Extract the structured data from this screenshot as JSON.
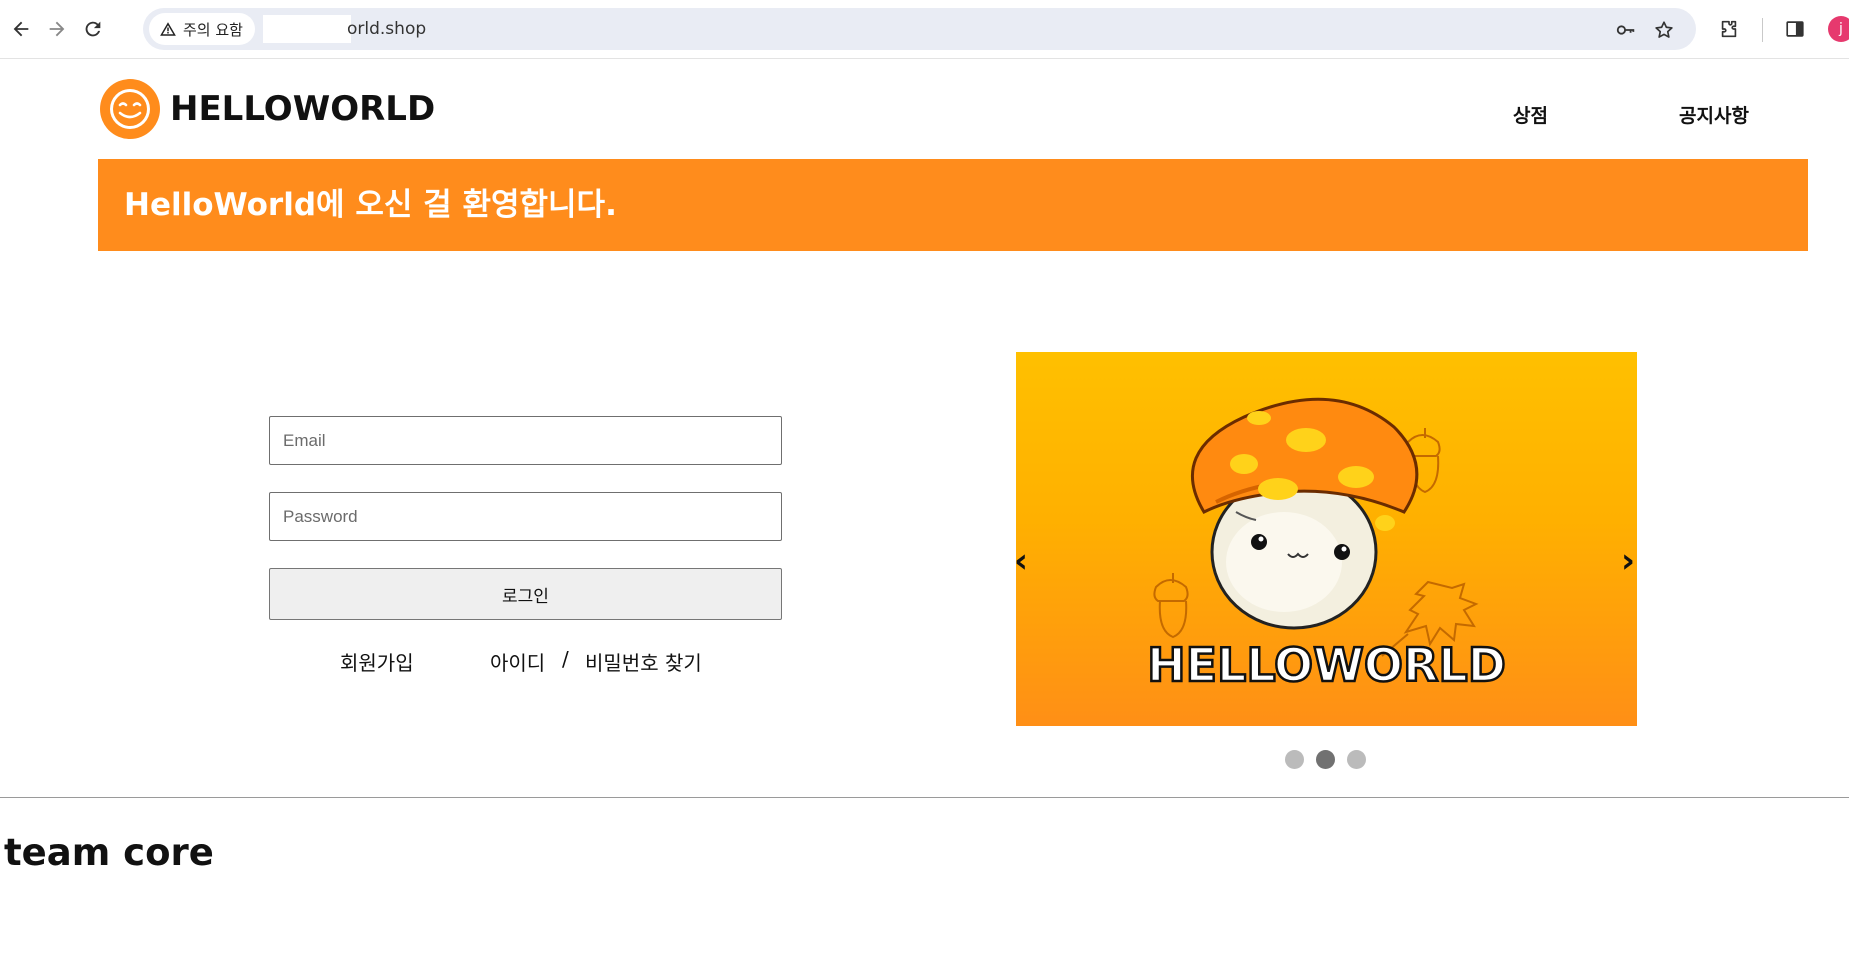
{
  "browser": {
    "security_label": "주의 요함",
    "url": "orld.shop"
  },
  "site": {
    "logo_text": "HELLOWORLD",
    "nav": {
      "shop": "상점",
      "notice": "공지사항"
    },
    "banner_title": "HelloWorld에 오신 걸 환영합니다."
  },
  "login": {
    "email_placeholder": "Email",
    "password_placeholder": "Password",
    "submit_label": "로그인",
    "signup_link": "회원가입",
    "find_id_link": "아이디",
    "separator": "/",
    "find_password_link": "비밀번호 찾기"
  },
  "carousel": {
    "caption": "HELLOWORLD",
    "prev_label": "‹",
    "next_label": "›",
    "slide_count": 3,
    "active_slide": 2
  },
  "footer": {
    "title": "team core"
  },
  "colors": {
    "brand_orange": "#ff8c1c",
    "carousel_top": "#ffc000",
    "profile": "#e6396e"
  }
}
